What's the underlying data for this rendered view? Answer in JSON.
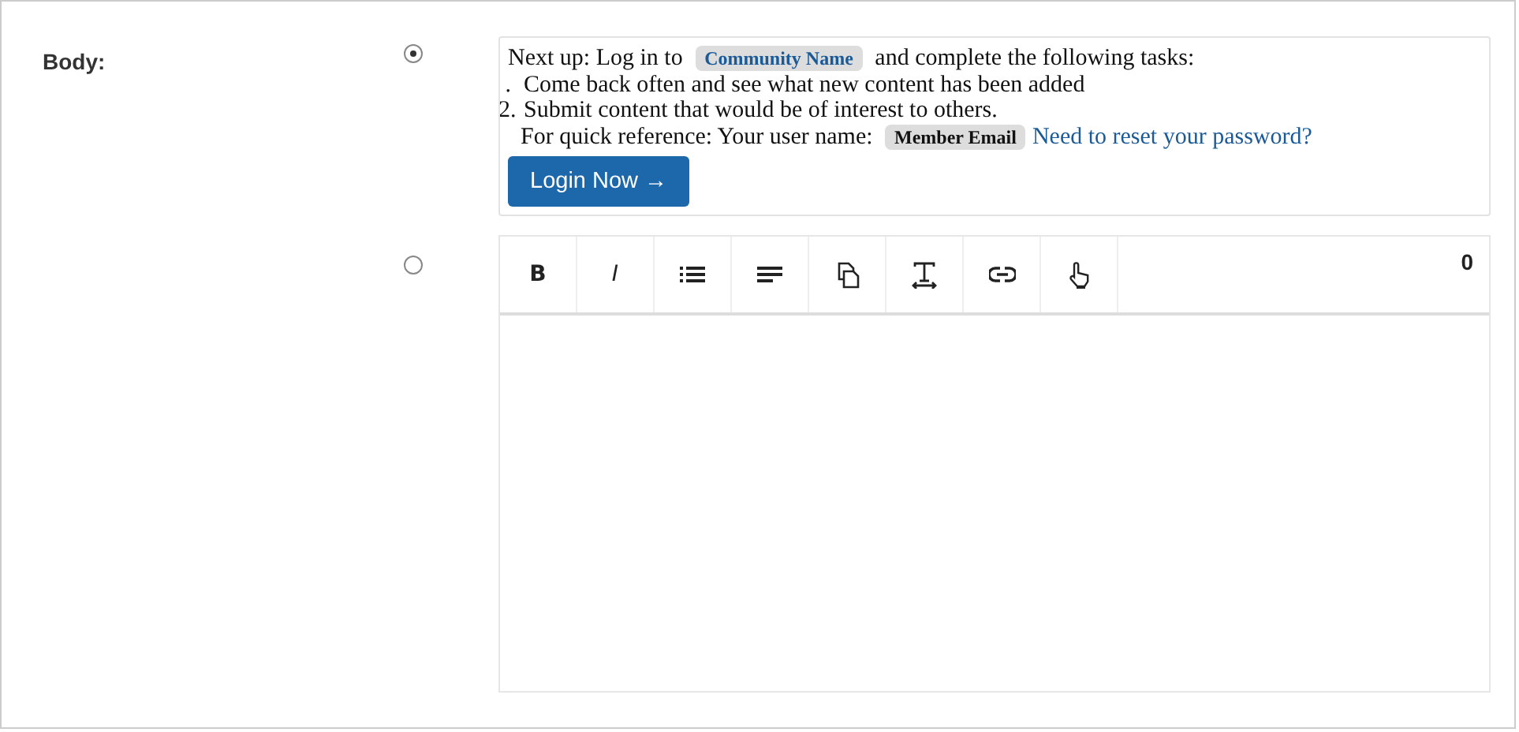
{
  "field": {
    "label": "Body:"
  },
  "options": [
    {
      "selected": true
    },
    {
      "selected": false
    }
  ],
  "preview": {
    "intro_before": "Next up: Log in to",
    "community_tag": "Community Name",
    "intro_after": "and complete the following tasks:",
    "tasks": [
      {
        "marker": ".",
        "text": "Come back often and see what new content has been added"
      },
      {
        "marker": "2.",
        "text": "Submit content that would be of interest to others."
      }
    ],
    "reference_label": "For quick reference: Your user name:",
    "member_tag": "Member Email",
    "reset_link": "Need to reset your password?",
    "login_button": "Login Now →"
  },
  "editor": {
    "toolbar": [
      {
        "kind": "text",
        "label": "B"
      },
      {
        "kind": "text",
        "label": "I"
      },
      {
        "kind": "list"
      },
      {
        "kind": "align"
      },
      {
        "kind": "copy"
      },
      {
        "kind": "textsize"
      },
      {
        "kind": "link"
      },
      {
        "kind": "pointer"
      }
    ],
    "counter": "0"
  }
}
